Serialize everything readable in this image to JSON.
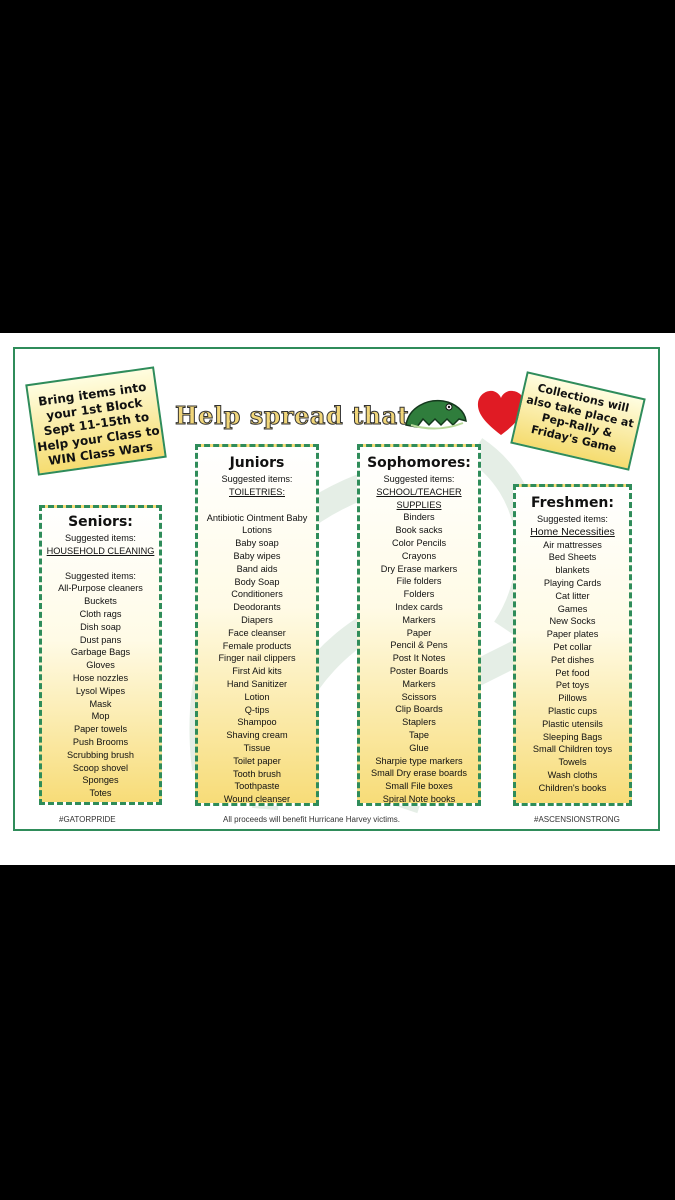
{
  "note_left": [
    "Bring items into",
    "your 1st Block",
    "Sept 11-15th to",
    "Help your Class to",
    "WIN Class Wars"
  ],
  "note_right": [
    "Collections will",
    "also take place at",
    "Pep-Rally &",
    "Friday's Game"
  ],
  "headline": "Help spread that",
  "icons": {
    "gator": "gator-icon",
    "heart": "heart-icon",
    "watermark": "gator-watermark-icon"
  },
  "colors": {
    "frame": "#2f8c5a",
    "note_fill": "#f5dc70",
    "heart": "#e01b24",
    "gator": "#2f7d3c"
  },
  "seniors": {
    "title": "Seniors:",
    "suggested": "Suggested items:",
    "category": "HOUSEHOLD CLEANING",
    "suggested2": "Suggested items:",
    "items": [
      "All-Purpose cleaners",
      "Buckets",
      "Cloth rags",
      "Dish soap",
      "Dust pans",
      "Garbage Bags",
      "Gloves",
      "Hose nozzles",
      "Lysol Wipes",
      "Mask",
      "Mop",
      "Paper towels",
      "Push Brooms",
      "Scrubbing brush",
      "Scoop shovel",
      "Sponges",
      "Totes"
    ]
  },
  "juniors": {
    "title": "Juniors",
    "suggested": "Suggested items:",
    "category": "TOILETRIES:",
    "items": [
      "Antibiotic Ointment Baby",
      "Lotions",
      "Baby soap",
      "Baby wipes",
      "Band aids",
      "Body Soap",
      "Conditioners",
      "Deodorants",
      "Diapers",
      "Face cleanser",
      "Female products",
      "Finger nail clippers",
      "First Aid kits",
      "Hand Sanitizer",
      "Lotion",
      "Q-tips",
      "Shampoo",
      "Shaving cream",
      "Tissue",
      "Toilet paper",
      "Tooth brush",
      "Toothpaste",
      "Wound cleanser"
    ]
  },
  "sophomores": {
    "title": "Sophomores:",
    "suggested": "Suggested items:",
    "category": "SCHOOL/TEACHER SUPPLIES",
    "items": [
      "Binders",
      "Book sacks",
      "Color Pencils",
      "Crayons",
      "Dry Erase markers",
      "File folders",
      "Folders",
      "Index cards",
      "Markers",
      "Paper",
      "Pencil & Pens",
      "Post It Notes",
      "Poster Boards",
      "Markers",
      "Scissors",
      "Clip Boards",
      "Staplers",
      "Tape",
      "Glue",
      "Sharpie type markers",
      "Small Dry erase boards",
      "Small File boxes",
      "Spiral Note books"
    ]
  },
  "freshmen": {
    "title": "Freshmen:",
    "suggested": "Suggested items:",
    "category": "Home Necessities",
    "items": [
      "Air mattresses",
      "Bed Sheets",
      "blankets",
      "Playing Cards",
      "Cat litter",
      "Games",
      "New Socks",
      "Paper plates",
      "Pet collar",
      "Pet dishes",
      "Pet food",
      "Pet toys",
      "Pillows",
      "Plastic cups",
      "Plastic utensils",
      "Sleeping Bags",
      "Small Children toys",
      "Towels",
      "Wash cloths",
      "Children's books"
    ]
  },
  "footer": {
    "left": "#GATORPRIDE",
    "center": "All proceeds will benefit Hurricane Harvey victims.",
    "right": "#ASCENSIONSTRONG"
  }
}
